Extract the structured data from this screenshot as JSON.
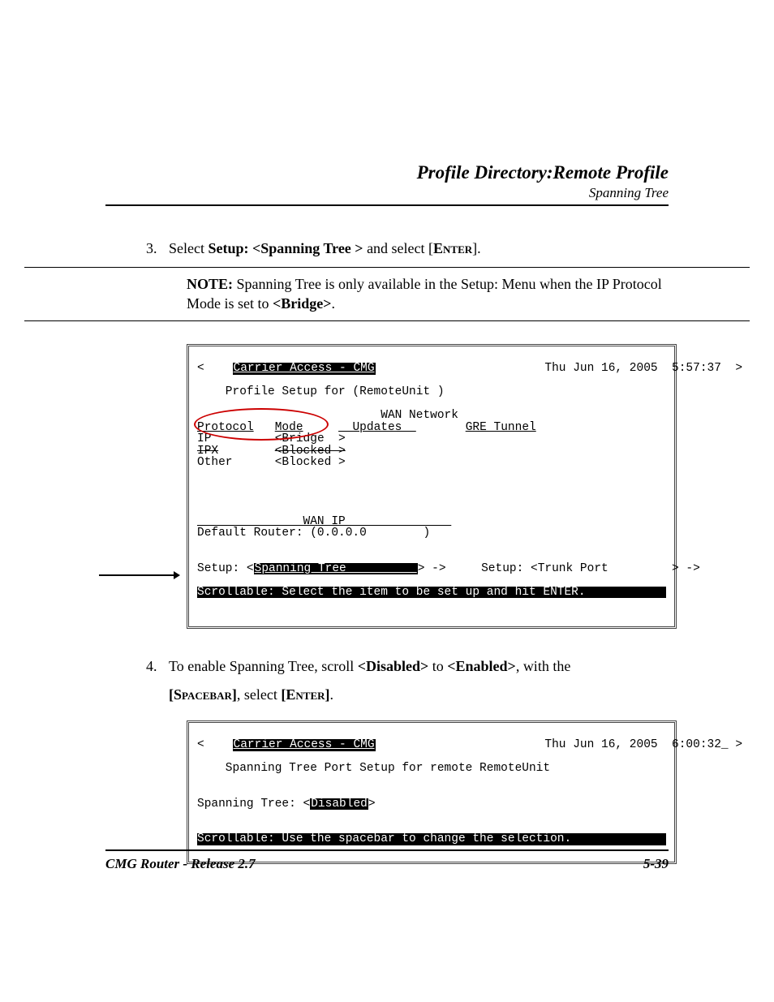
{
  "header": {
    "title": "Profile Directory:Remote Profile",
    "subtitle": "Spanning Tree"
  },
  "step3": {
    "num": "3.",
    "t1": "Select ",
    "setup": "Setup:  <Spanning Tree  >",
    "t2": " and select [",
    "enter": "Enter",
    "t3": "]."
  },
  "note": {
    "label": "NOTE:",
    "t1": "  Spanning Tree is only available in the Setup: Menu when the IP Protocol Mode is set to ",
    "bridge": "<Bridge>",
    "t2": "."
  },
  "term1": {
    "lt": "<",
    "gt": ">",
    "title": "Carrier Access - CMG",
    "ts": "Thu Jun 16, 2005  5:57:37",
    "l2": "    Profile Setup for (RemoteUnit )",
    "l3a": "                          WAN Network",
    "col_proto": "Protocol",
    "col_mode": "Mode",
    "col_upd": "  Updates  ",
    "col_gre": "GRE Tunnel",
    "r1a": "IP",
    "r1b": "<Bridge  >",
    "r2a": "IPX",
    "r2b": "<Blocked >",
    "r3a": "Other",
    "r3b": "<Blocked >",
    "wanip_hdr": "               WAN IP               ",
    "wanip_row": "Default Router: (0.0.0.0        )",
    "setup1_pre": "Setup: <",
    "setup1_val": "Spanning Tree          ",
    "setup1_post": "> ->",
    "setup2": "Setup: <Trunk Port         > ->",
    "status": "Scrollable: Select the item to be set up and hit ENTER."
  },
  "step4": {
    "num": "4.",
    "t1": "To enable Spanning Tree, scroll ",
    "dis": "<Disabled>",
    "t2": " to ",
    "en": "<Enabled>",
    "t3": ", with the ",
    "space_open": "[",
    "space": "Spacebar",
    "space_close": "]",
    "t4": ", select ",
    "ent_open": "[",
    "ent": "Enter",
    "ent_close": "]",
    "t5": "."
  },
  "term2": {
    "lt": "<",
    "gt": ">",
    "title": "Carrier Access - CMG",
    "ts": "Thu Jun 16, 2005  6:00:32_",
    "l2": "    Spanning Tree Port Setup for remote RemoteUnit",
    "l3_pre": "Spanning Tree: <",
    "l3_val": "Disabled",
    "l3_post": ">",
    "status": "Scrollable: Use the spacebar to change the selection."
  },
  "footer": {
    "left": "CMG Router - Release 2.7",
    "right": "5-39"
  }
}
